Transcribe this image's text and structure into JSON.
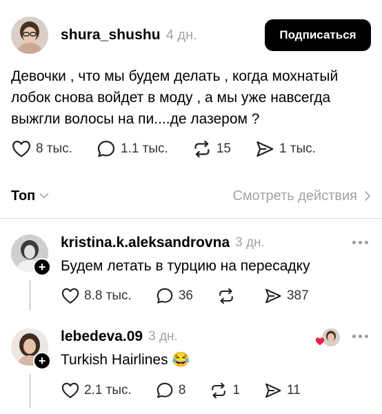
{
  "post": {
    "author": "shura_shushu",
    "time": "4 дн.",
    "follow_label": "Подписаться",
    "text": "Девочки , что мы будем делать , когда мохнатый лобок снова войдет в моду , а мы уже навсегда выжгли волосы на пи....де лазером ?",
    "likes": "8 тыс.",
    "replies": "1.1 тыс.",
    "reposts": "15",
    "shares": "1 тыс."
  },
  "sort": {
    "label": "Топ",
    "view_activity": "Смотреть действия"
  },
  "comments": [
    {
      "author": "kristina.k.aleksandrovna",
      "time": "3 дн.",
      "text": "Будем летать в турцию на пересадку",
      "likes": "8.8 тыс.",
      "replies": "36",
      "reposts": "",
      "shares": "387"
    },
    {
      "author": "lebedeva.09",
      "time": "3 дн.",
      "text": "Turkish Hairlines 😂",
      "likes": "2.1 тыс.",
      "replies": "8",
      "reposts": "1",
      "shares": "11"
    }
  ],
  "icons": {
    "like": "heart-icon",
    "reply": "comment-bubble-icon",
    "repost": "repost-icon",
    "share": "send-icon",
    "follow_plus": "plus-icon",
    "more": "more-dots-icon",
    "author_liked": "red-heart-icon"
  },
  "colors": {
    "text": "#000000",
    "muted": "#a3a3a3",
    "divider": "#dcdcdc",
    "button": "#000000",
    "heart_badge": "#e8224d"
  }
}
